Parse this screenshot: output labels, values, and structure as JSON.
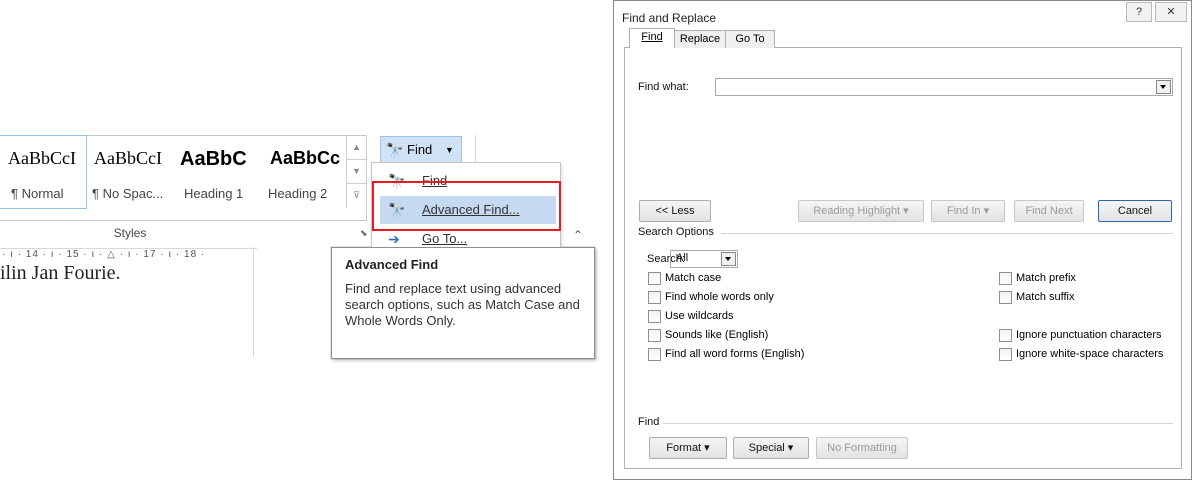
{
  "ribbon": {
    "styles": [
      {
        "preview": "AaBbCcI",
        "name": "¶ Normal"
      },
      {
        "preview": "AaBbCcI",
        "name": "¶ No Spac..."
      },
      {
        "preview": "AaBbC",
        "name": "Heading 1"
      },
      {
        "preview": "AaBbCc",
        "name": "Heading 2"
      }
    ],
    "styles_group_label": "Styles",
    "find_button": "Find",
    "menu": {
      "find": "Find",
      "advanced_find": "Advanced Find...",
      "goto": "Go To..."
    }
  },
  "ruler_text": "· ı · 14 · ı · 15 · ı · △ · ı · 17 · ı · 18 ·",
  "document_text": "ilin Jan Fourie.",
  "tooltip": {
    "title": "Advanced Find",
    "body": "Find and replace text using advanced search options, such as Match Case and Whole Words Only."
  },
  "dialog": {
    "title": "Find and Replace",
    "help_btn": "?",
    "close_btn": "✕",
    "tabs": [
      "Find",
      "Replace",
      "Go To"
    ],
    "find_what_label": "Find what:",
    "find_what_value": "",
    "buttons": {
      "less": "<< Less",
      "reading_highlight": "Reading Highlight ▾",
      "find_in": "Find In ▾",
      "find_next": "Find Next",
      "cancel": "Cancel"
    },
    "search_options_label": "Search Options",
    "search_label": "Search:",
    "search_value": "All",
    "options_left": [
      "Match case",
      "Find whole words only",
      "Use wildcards",
      "Sounds like (English)",
      "Find all word forms (English)"
    ],
    "options_right": [
      "Match prefix",
      "Match suffix",
      "Ignore punctuation characters",
      "Ignore white-space characters"
    ],
    "find_section_label": "Find",
    "bottom_buttons": {
      "format": "Format ▾",
      "special": "Special ▾",
      "no_formatting": "No Formatting"
    }
  },
  "colors": {
    "highlight": "#c5d9f1",
    "red_outline": "#e81b23",
    "find_btn": "#cfe2f6"
  }
}
